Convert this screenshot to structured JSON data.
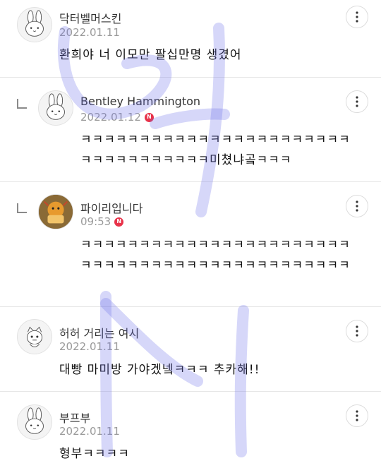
{
  "comments": [
    {
      "author": "닥터벨머스킨",
      "date": "2022.01.11",
      "text": "환희야 너 이모만 팔십만명 생겼어",
      "badge": "",
      "is_reply": false,
      "avatar": "bunny"
    },
    {
      "author": "Bentley Hammington",
      "date": "2022.01.12",
      "text": "ㅋㅋㅋㅋㅋㅋㅋㅋㅋㅋㅋㅋㅋㅋㅋㅋㅋㅋㅋㅋㅋㅋㅋㅋㅋㅋㅋㅋㅋㅋㅋㅋㅋㅋ미쳤냐곸ㅋㅋㅋ",
      "badge": "N",
      "is_reply": true,
      "avatar": "bunny"
    },
    {
      "author": "파이리입니다",
      "date": "09:53",
      "text": "ㅋㅋㅋㅋㅋㅋㅋㅋㅋㅋㅋㅋㅋㅋㅋㅋㅋㅋㅋㅋㅋㅋㅋㅋㅋㅋㅋㅋㅋㅋㅋㅋㅋㅋㅋㅋㅋㅋㅋㅋㅋㅋㅋㅋㅋㅋ",
      "badge": "N",
      "is_reply": true,
      "avatar": "photo"
    },
    {
      "author": "허허 거리는 여시",
      "date": "2022.01.11",
      "text": "대빵 마미방 가야겠넼ㅋㅋㅋ 추카해!!",
      "badge": "",
      "is_reply": false,
      "avatar": "fox"
    },
    {
      "author": "부프부",
      "date": "2022.01.11",
      "text": "형부ㅋㅋㅋㅋ",
      "badge": "",
      "is_reply": false,
      "avatar": "bunny"
    }
  ],
  "icons": {
    "more": "more-vertical-icon",
    "reply": "reply-arrow-icon",
    "new_badge_color": "#e8334a"
  },
  "watermark_color": "#6b6ee8"
}
